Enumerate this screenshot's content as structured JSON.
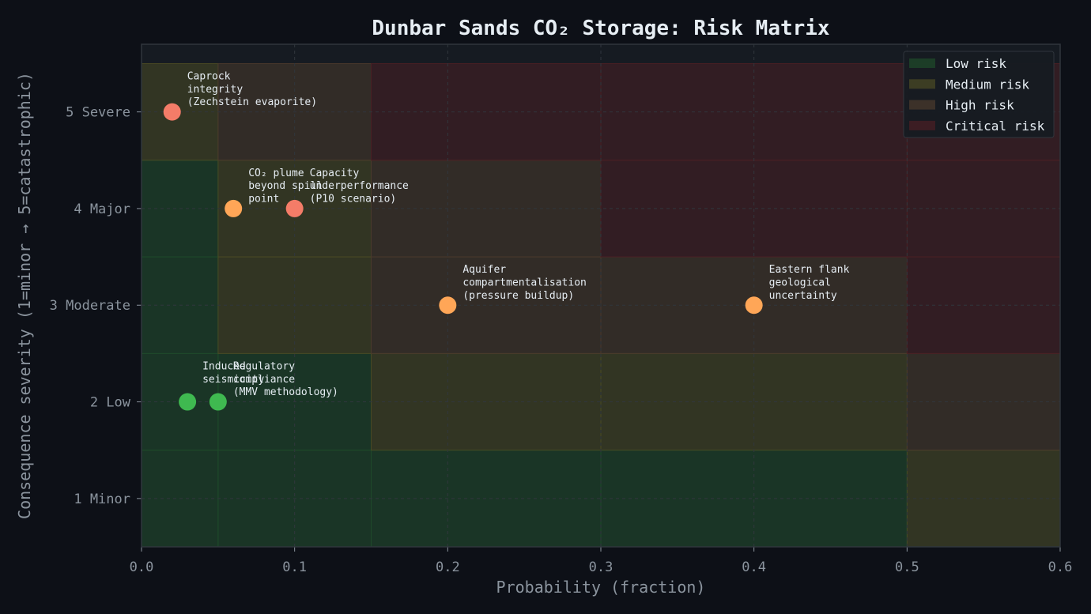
{
  "chart_data": {
    "type": "scatter",
    "title": "Dunbar Sands CO₂ Storage: Risk Matrix",
    "xlabel": "Probability (fraction)",
    "ylabel": "Consequence severity (1=minor → 5=catastrophic)",
    "xlim": [
      0.0,
      0.6
    ],
    "ylim": [
      0.5,
      5.7
    ],
    "grid": true,
    "legend_position": "top-right",
    "x_ticks": [
      "0.0",
      "0.1",
      "0.2",
      "0.3",
      "0.4",
      "0.5",
      "0.6"
    ],
    "y_ticks": [
      "1 Minor",
      "2 Low",
      "3 Moderate",
      "4 Major",
      "5 Severe"
    ],
    "risk_categories": [
      {
        "name": "Low risk",
        "color": "#1f4a2a"
      },
      {
        "name": "Medium risk",
        "color": "#4a4a24"
      },
      {
        "name": "High risk",
        "color": "#4a3a2c"
      },
      {
        "name": "Critical risk",
        "color": "#4a1f24"
      }
    ],
    "matrix_cells": [
      {
        "x0": 0.0,
        "x1": 0.05,
        "severity": 1,
        "risk": "Low risk"
      },
      {
        "x0": 0.05,
        "x1": 0.15,
        "severity": 1,
        "risk": "Low risk"
      },
      {
        "x0": 0.15,
        "x1": 0.3,
        "severity": 1,
        "risk": "Low risk"
      },
      {
        "x0": 0.3,
        "x1": 0.5,
        "severity": 1,
        "risk": "Low risk"
      },
      {
        "x0": 0.5,
        "x1": 0.6,
        "severity": 1,
        "risk": "Medium risk"
      },
      {
        "x0": 0.0,
        "x1": 0.05,
        "severity": 2,
        "risk": "Low risk"
      },
      {
        "x0": 0.05,
        "x1": 0.15,
        "severity": 2,
        "risk": "Low risk"
      },
      {
        "x0": 0.15,
        "x1": 0.3,
        "severity": 2,
        "risk": "Medium risk"
      },
      {
        "x0": 0.3,
        "x1": 0.5,
        "severity": 2,
        "risk": "Medium risk"
      },
      {
        "x0": 0.5,
        "x1": 0.6,
        "severity": 2,
        "risk": "High risk"
      },
      {
        "x0": 0.0,
        "x1": 0.05,
        "severity": 3,
        "risk": "Low risk"
      },
      {
        "x0": 0.05,
        "x1": 0.15,
        "severity": 3,
        "risk": "Medium risk"
      },
      {
        "x0": 0.15,
        "x1": 0.3,
        "severity": 3,
        "risk": "High risk"
      },
      {
        "x0": 0.3,
        "x1": 0.5,
        "severity": 3,
        "risk": "High risk"
      },
      {
        "x0": 0.5,
        "x1": 0.6,
        "severity": 3,
        "risk": "Critical risk"
      },
      {
        "x0": 0.0,
        "x1": 0.05,
        "severity": 4,
        "risk": "Low risk"
      },
      {
        "x0": 0.05,
        "x1": 0.15,
        "severity": 4,
        "risk": "Medium risk"
      },
      {
        "x0": 0.15,
        "x1": 0.3,
        "severity": 4,
        "risk": "High risk"
      },
      {
        "x0": 0.3,
        "x1": 0.5,
        "severity": 4,
        "risk": "Critical risk"
      },
      {
        "x0": 0.5,
        "x1": 0.6,
        "severity": 4,
        "risk": "Critical risk"
      },
      {
        "x0": 0.0,
        "x1": 0.05,
        "severity": 5,
        "risk": "Medium risk"
      },
      {
        "x0": 0.05,
        "x1": 0.15,
        "severity": 5,
        "risk": "High risk"
      },
      {
        "x0": 0.15,
        "x1": 0.3,
        "severity": 5,
        "risk": "Critical risk"
      },
      {
        "x0": 0.3,
        "x1": 0.5,
        "severity": 5,
        "risk": "Critical risk"
      },
      {
        "x0": 0.5,
        "x1": 0.6,
        "severity": 5,
        "risk": "Critical risk"
      }
    ],
    "points": [
      {
        "label": "Caprock\nintegrity\n(Zechstein evaporite)",
        "x": 0.02,
        "y": 5,
        "color": "#f47c68"
      },
      {
        "label": "CO₂ plume\nbeyond spill\npoint",
        "x": 0.06,
        "y": 4,
        "color": "#ffa657"
      },
      {
        "label": "Capacity\nunderperformance\n(P10 scenario)",
        "x": 0.1,
        "y": 4,
        "color": "#f47c68"
      },
      {
        "label": "Aquifer\ncompartmentalisation\n(pressure buildup)",
        "x": 0.2,
        "y": 3,
        "color": "#ffa657"
      },
      {
        "label": "Eastern flank\ngeological\nuncertainty",
        "x": 0.4,
        "y": 3,
        "color": "#ffa657"
      },
      {
        "label": "Induced\nseismicity",
        "x": 0.03,
        "y": 2,
        "color": "#3fb950"
      },
      {
        "label": "Regulatory\ncompliance\n(MMV methodology)",
        "x": 0.05,
        "y": 2,
        "color": "#3fb950"
      }
    ]
  }
}
